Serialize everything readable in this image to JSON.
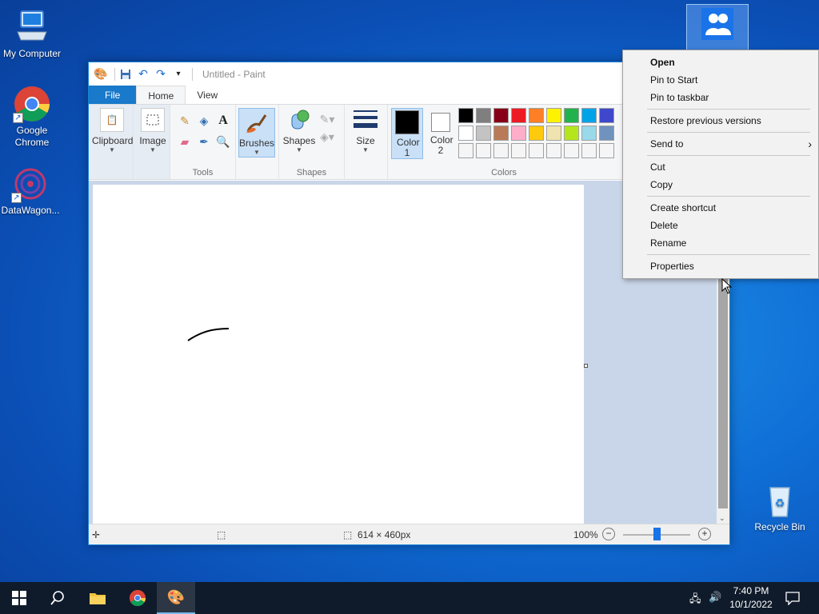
{
  "desktop": {
    "icons": [
      {
        "label": "My Computer"
      },
      {
        "label": "Google Chrome"
      },
      {
        "label": "DataWagon..."
      },
      {
        "label": "Recycle Bin"
      }
    ]
  },
  "paint": {
    "title": "Untitled - Paint",
    "tabs": {
      "file": "File",
      "home": "Home",
      "view": "View"
    },
    "ribbon": {
      "clipboard": "Clipboard",
      "image": "Image",
      "tools_group": "Tools",
      "brushes": "Brushes",
      "shapes_btn": "Shapes",
      "shapes_group": "Shapes",
      "size": "Size",
      "color1": "Color 1",
      "color2": "Color 2",
      "colors_group": "Colors"
    },
    "palette_row1": [
      "#000000",
      "#7f7f7f",
      "#880015",
      "#ed1c24",
      "#ff7f27",
      "#fff200",
      "#22b14c",
      "#00a2e8",
      "#3f48cc",
      "#a349a4"
    ],
    "palette_row2": [
      "#ffffff",
      "#c3c3c3",
      "#b97a57",
      "#ffaec9",
      "#ffc90e",
      "#efe4b0",
      "#b5e61d",
      "#99d9ea",
      "#7092be",
      "#c8bfe7"
    ],
    "status": {
      "dimensions": "614 × 460px",
      "zoom": "100%"
    }
  },
  "context_menu": {
    "open": "Open",
    "pin_start": "Pin to Start",
    "pin_taskbar": "Pin to taskbar",
    "restore": "Restore previous versions",
    "send_to": "Send to",
    "cut": "Cut",
    "copy": "Copy",
    "create_shortcut": "Create shortcut",
    "delete": "Delete",
    "rename": "Rename",
    "properties": "Properties"
  },
  "taskbar": {
    "time": "7:40 PM",
    "date": "10/1/2022"
  }
}
